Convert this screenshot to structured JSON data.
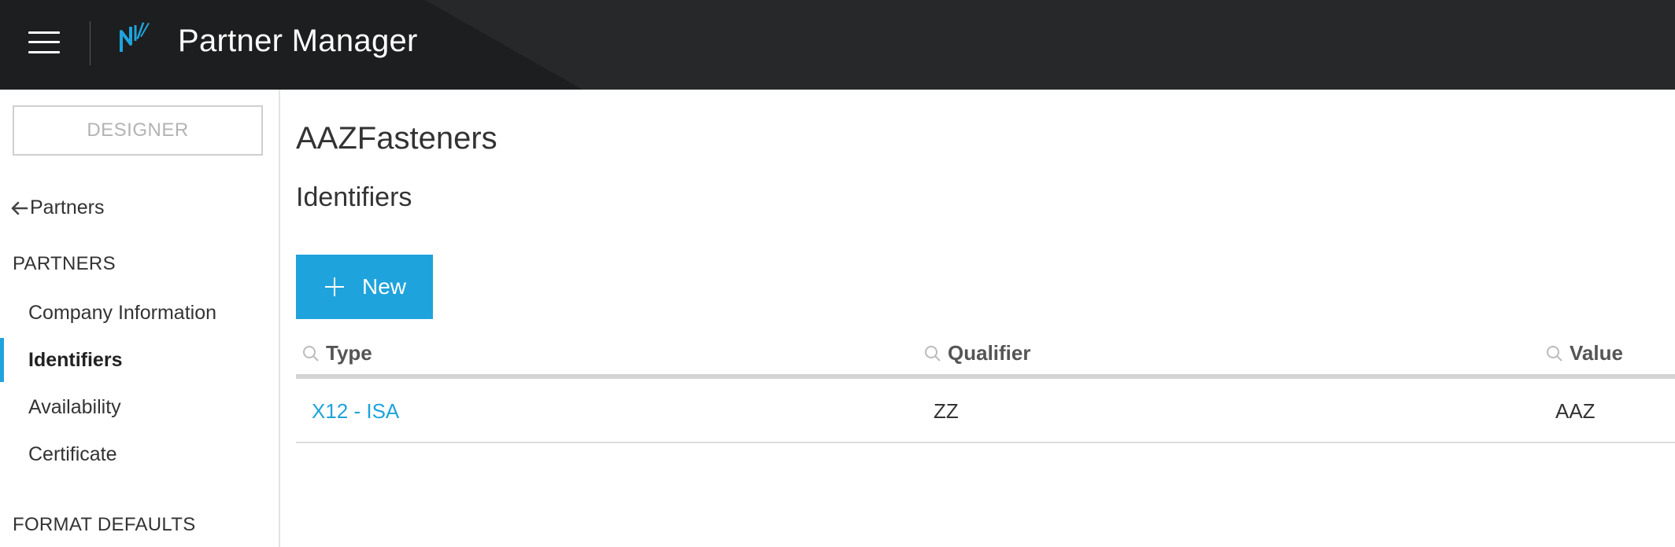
{
  "header": {
    "app_title": "Partner Manager",
    "menu_icon": "hamburger-menu-icon",
    "logo_icon": "app-logo-icon",
    "colors": {
      "bar": "#27282a",
      "accent": "#1fa3dc"
    }
  },
  "sidebar": {
    "designer_label": "DESIGNER",
    "back_label": "Partners",
    "partners_heading": "PARTNERS",
    "items": [
      {
        "label": "Company Information",
        "active": false
      },
      {
        "label": "Identifiers",
        "active": true
      },
      {
        "label": "Availability",
        "active": false
      },
      {
        "label": "Certificate",
        "active": false
      }
    ],
    "format_heading": "FORMAT DEFAULTS"
  },
  "main": {
    "partner_name": "AAZFasteners",
    "section_title": "Identifiers",
    "new_button_label": "New",
    "table": {
      "columns": [
        "Type",
        "Qualifier",
        "Value"
      ],
      "rows": [
        {
          "type": "X12 - ISA",
          "qualifier": "ZZ",
          "value": "AAZ"
        }
      ]
    }
  }
}
